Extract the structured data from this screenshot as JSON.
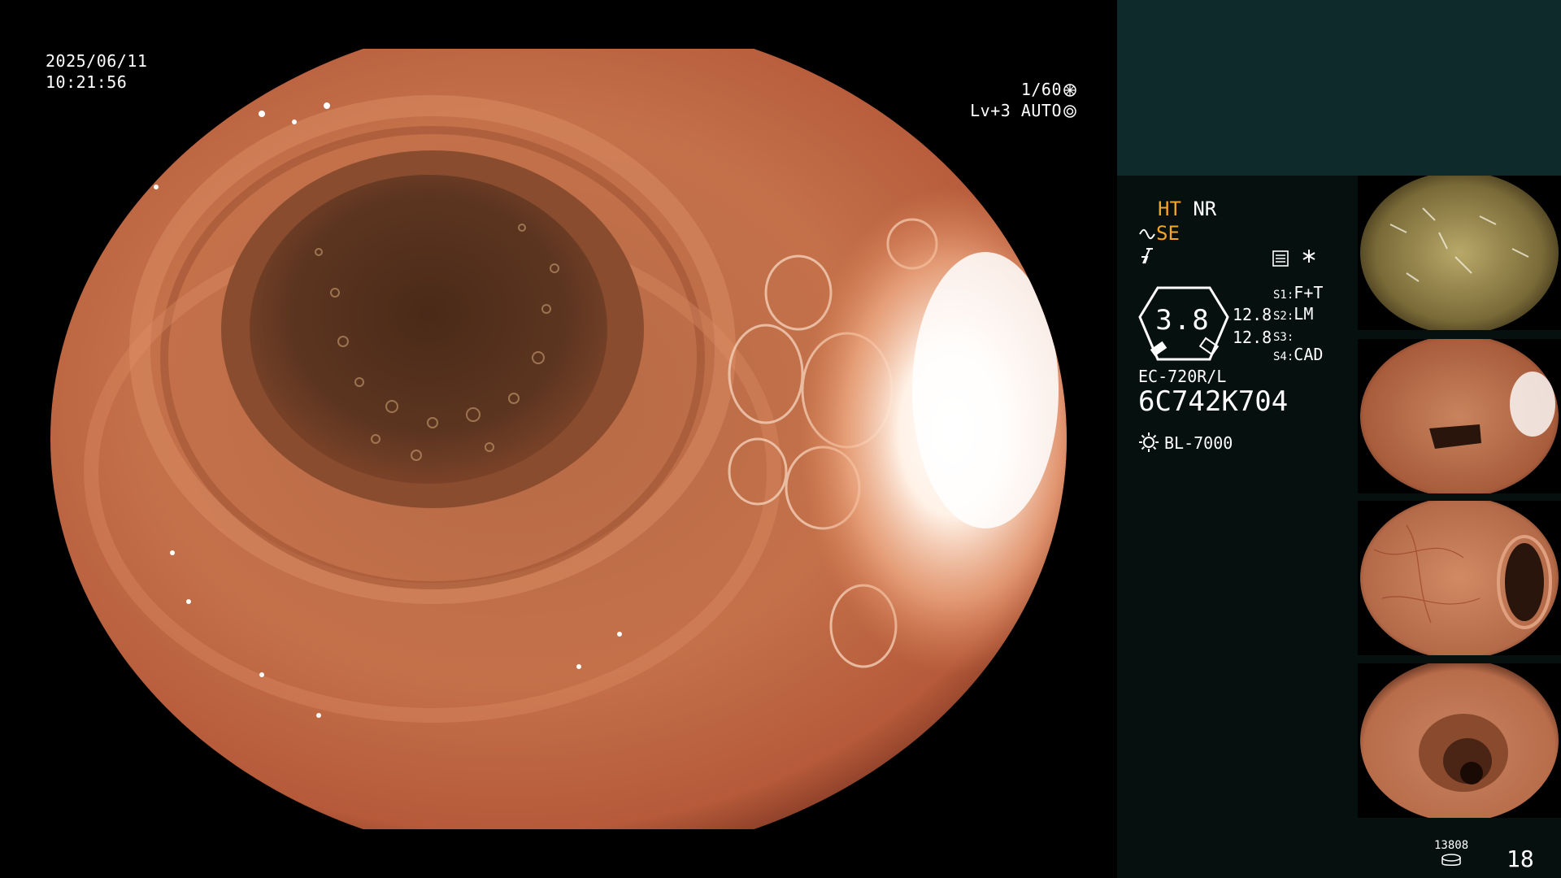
{
  "osd": {
    "date": "2025/06/11",
    "time": "10:21:56",
    "shutter": "1/60",
    "level": "Lv+3",
    "auto": "AUTO"
  },
  "panel": {
    "ht": "HT",
    "nr": "NR",
    "se": "SE",
    "gauge_value": "3.8",
    "gauge_num1": "12.8",
    "gauge_num2": "12.8",
    "switches": [
      {
        "key": "S1:",
        "value": "F+T"
      },
      {
        "key": "S2:",
        "value": "LM"
      },
      {
        "key": "S3:",
        "value": ""
      },
      {
        "key": "S4:",
        "value": "CAD"
      }
    ],
    "scope_model": "EC-720R/L",
    "serial": "6C742K704",
    "light_source": "BL-7000",
    "counter_small": "13808",
    "counter_big": "18"
  },
  "icons": [
    "shutter-icon",
    "auto-iris-icon",
    "se-curve-icon",
    "flash-icon",
    "menu-icon",
    "star-icon",
    "lamp-icon",
    "disc-icon"
  ],
  "colors": {
    "accent_yellow": "#f5a623",
    "panel_top": "#0e2a2a",
    "panel_bg": "#06100f",
    "tissue": "#c8704a"
  }
}
